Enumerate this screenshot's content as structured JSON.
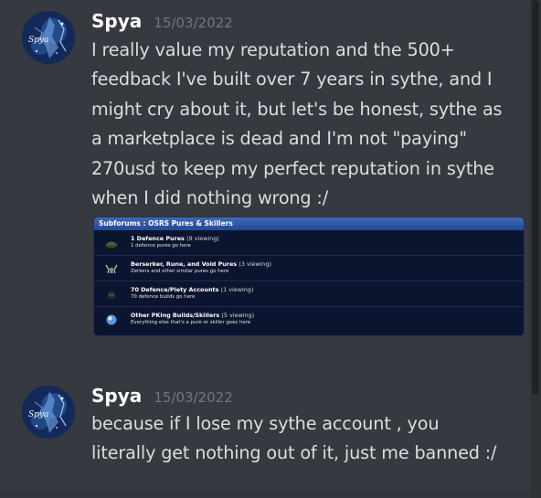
{
  "messages": [
    {
      "username": "Spya",
      "timestamp": "15/03/2022",
      "avatar_label": "Spya",
      "text": "I really value my reputation and the 500+\nfeedback I've built over 7 years in sythe, and I\nmight cry about it, but let's be honest, sythe as\na marketplace is dead and I'm not \"paying\"\n270usd to keep my perfect reputation in sythe\nwhen I did nothing wrong :/",
      "embed": {
        "header": "Subforums : OSRS Pures & Skillers",
        "rows": [
          {
            "title": "1 Defence Pures",
            "viewing": "(9 viewing)",
            "description": "1 defence pures go here",
            "icon": "helmet-icon"
          },
          {
            "title": "Berserker, Rune, and Void Pures",
            "viewing": "(3 viewing)",
            "description": "Zerkers and other similar pures go here",
            "icon": "horned-helm-icon"
          },
          {
            "title": "70 Defence/Piety Accounts",
            "viewing": "(1 viewing)",
            "description": "70 defence builds go here",
            "icon": "dark-helm-icon"
          },
          {
            "title": "Other PKing Builds/Skillers",
            "viewing": "(5 viewing)",
            "description": "Everything else that's a pure or skiller goes here",
            "icon": "orb-icon"
          }
        ]
      }
    },
    {
      "username": "Spya",
      "timestamp": "15/03/2022",
      "avatar_label": "Spya",
      "text": "because if I lose my sythe account , you\nliterally get nothing out of it, just me banned :/"
    }
  ],
  "colors": {
    "background": "#36393f",
    "username": "#ffffff",
    "timestamp": "#72767d",
    "message_text": "#dcddde",
    "embed_header": "#2c5599",
    "embed_body": "#0c1530"
  }
}
